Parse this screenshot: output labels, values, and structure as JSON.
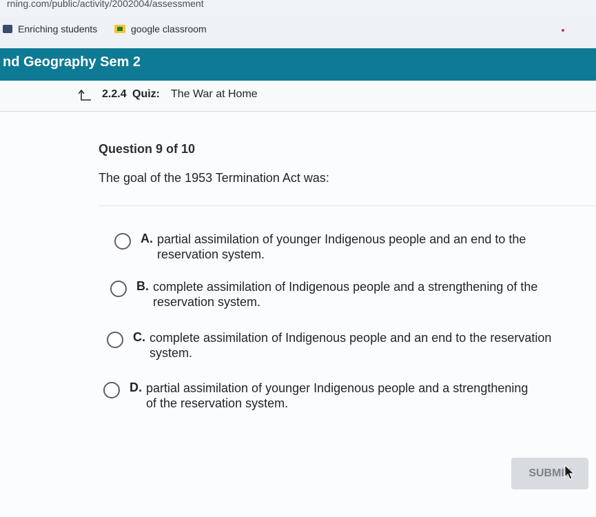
{
  "browser": {
    "url": "rning.com/public/activity/2002004/assessment",
    "bookmarks": [
      {
        "label": "Enriching students",
        "icon": "bookmark-page-icon"
      },
      {
        "label": "google classroom",
        "icon": "google-classroom-icon"
      }
    ]
  },
  "course": {
    "title": "nd Geography Sem 2"
  },
  "activity": {
    "id": "2.2.4",
    "type": "Quiz:",
    "title": "The War at Home"
  },
  "question": {
    "counter": "Question 9 of 10",
    "prompt": "The goal of the 1953 Termination Act was:",
    "options": [
      {
        "letter": "A.",
        "text": "partial assimilation of younger Indigenous people and an end to the reservation system."
      },
      {
        "letter": "B.",
        "text": "complete assimilation of Indigenous people and a strengthening of the reservation system."
      },
      {
        "letter": "C.",
        "text": "complete assimilation of Indigenous people and an end to the reservation system."
      },
      {
        "letter": "D.",
        "text": "partial assimilation of younger Indigenous people and a strengthening of the reservation system."
      }
    ]
  },
  "actions": {
    "submit_label": "SUBMIT"
  },
  "colors": {
    "header": "#0e7a94",
    "submit_bg": "#d8dbe0"
  }
}
